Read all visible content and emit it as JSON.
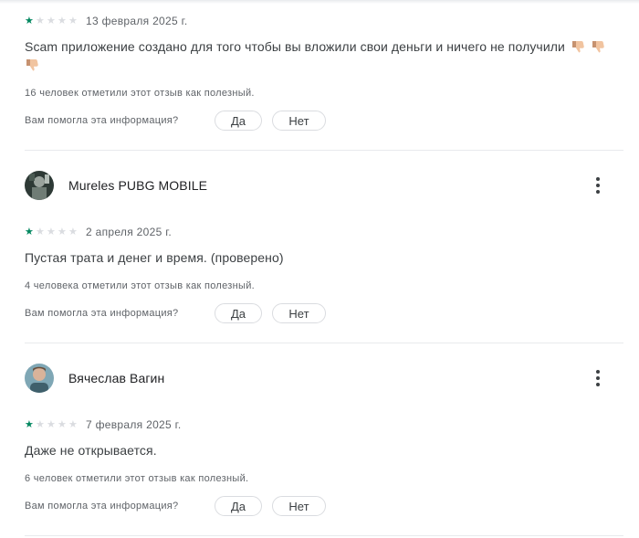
{
  "reviews": [
    {
      "author": "",
      "rating": 1,
      "stars": [
        "★",
        "★",
        "★",
        "★",
        "★"
      ],
      "date": "13 февраля 2025 г.",
      "text": "Scam приложение создано для того чтобы вы вложили свои деньги и ничего не получили",
      "emojis": [
        "thumbs-down",
        "thumbs-down",
        "thumbs-down"
      ],
      "helpful_count_text": "16 человек отметили этот отзыв как полезный.",
      "question": "Вам помогла эта информация?",
      "yes_label": "Да",
      "no_label": "Нет"
    },
    {
      "author": "Mureles PUBG MOBILE",
      "rating": 1,
      "stars": [
        "★",
        "★",
        "★",
        "★",
        "★"
      ],
      "date": "2 апреля 2025 г.",
      "text": "Пустая трата и денег и время. (проверено)",
      "helpful_count_text": "4 человека отметили этот отзыв как полезный.",
      "question": "Вам помогла эта информация?",
      "yes_label": "Да",
      "no_label": "Нет"
    },
    {
      "author": "Вячеслав Вагин",
      "rating": 1,
      "stars": [
        "★",
        "★",
        "★",
        "★",
        "★"
      ],
      "date": "7 февраля 2025 г.",
      "text": "Даже не открывается.",
      "helpful_count_text": "6 человек отметили этот отзыв как полезный.",
      "question": "Вам помогла эта информация?",
      "yes_label": "Да",
      "no_label": "Нет"
    }
  ],
  "icons": {
    "menu": "more-vert-icon",
    "star": "star-icon",
    "emoji": "thumbs-down-emoji"
  },
  "colors": {
    "star_filled": "#01875f",
    "star_empty": "#dadce0",
    "divider": "#e8eaed",
    "secondary_text": "#5f6368"
  }
}
